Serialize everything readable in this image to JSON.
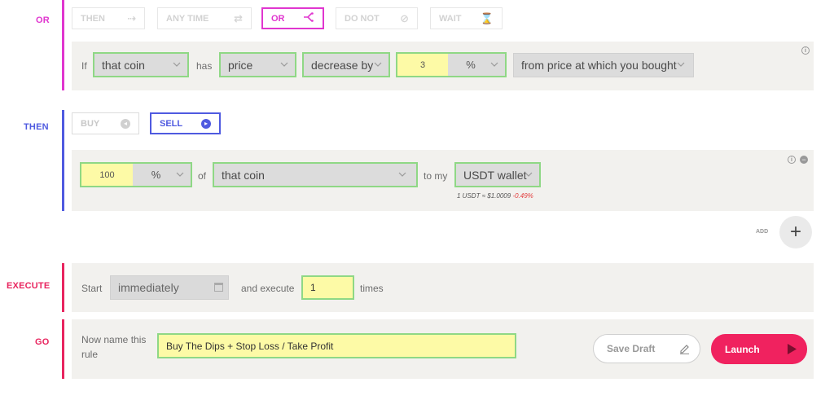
{
  "or_section": {
    "label": "OR",
    "tabs": [
      {
        "label": "THEN",
        "icon": "double-arrow-icon"
      },
      {
        "label": "ANY TIME",
        "icon": "swap-arrows-icon"
      },
      {
        "label": "OR",
        "icon": "branch-icon"
      },
      {
        "label": "DO NOT",
        "icon": "forbidden-icon"
      },
      {
        "label": "WAIT",
        "icon": "hourglass-icon"
      }
    ],
    "condition": {
      "if_label": "If",
      "subject": "that coin",
      "has_label": "has",
      "metric": "price",
      "direction": "decrease by",
      "amount": "3",
      "unit": "%",
      "reference": "from price at which you bought"
    }
  },
  "then_section": {
    "label": "THEN",
    "buy_label": "BUY",
    "sell_label": "SELL",
    "action": {
      "amount": "100",
      "unit": "%",
      "of_label": "of",
      "asset": "that coin",
      "to_label": "to my",
      "wallet": "USDT wallet",
      "rate_text": "1 USDT ≈ $1.0009",
      "rate_change": "-0.49%"
    },
    "add_label": "ADD"
  },
  "execute_section": {
    "label": "EXECUTE",
    "start_label": "Start",
    "start_value": "immediately",
    "and_execute_label": "and execute",
    "times_value": "1",
    "times_label": "times"
  },
  "go_section": {
    "label": "GO",
    "name_prompt": "Now name this rule",
    "rule_name": "Buy The Dips + Stop Loss / Take Profit",
    "save_draft_label": "Save Draft",
    "launch_label": "Launch"
  },
  "colors": {
    "or_accent": "#e036cf",
    "then_accent": "#4f5ae0",
    "execute_accent": "#e8255f",
    "launch_bg": "#f0225f",
    "field_border": "#8fd885",
    "field_yellow": "#fdfaa6"
  }
}
